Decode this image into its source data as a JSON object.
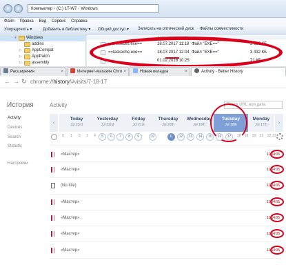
{
  "explorer": {
    "path": [
      "Компьютер",
      "(C:) 1T-W7",
      "Windows"
    ],
    "menu": [
      "Файл",
      "Правка",
      "Вид",
      "Сервис",
      "Справка"
    ],
    "toolbar": [
      "Упорядочить ▾",
      "Добавить в библиотеку ▾",
      "Общий доступ ▾",
      "Записать на оптический диск",
      "Файлы совместимости"
    ],
    "tree": [
      "Windows",
      "addins",
      "AppCompat",
      "AppPatch",
      "assembly"
    ],
    "files": [
      {
        "name": "",
        "date": "дата изменения",
        "type": "",
        "size": ""
      },
      {
        "name": "==msseces.exe==",
        "date": "18.07.2017 11:18",
        "type": "Файл \"EXE==\"",
        "size": "3 636 КБ"
      },
      {
        "name": "==taskeche.exe==",
        "date": "18.07.2017 12:04",
        "type": "Файл \"EXE==\"",
        "size": "3 432 КБ"
      },
      {
        "name": "",
        "date": "01.02.2016 10:25",
        "type": "",
        "size": "71 КБ"
      }
    ]
  },
  "browser": {
    "tabs": [
      {
        "label": "Расширения",
        "color": "#6b7b93"
      },
      {
        "label": "Интернет-магазин Chro",
        "color": "#d44638"
      },
      {
        "label": "Новая вкладка",
        "color": "#8ab4f8"
      },
      {
        "label": "Activity - Better History",
        "color": "#5f6368"
      }
    ],
    "url_prefix": "chrome://",
    "url_host": "history",
    "url_path": "/#visits/7-18-17"
  },
  "sidebar": {
    "title": "История",
    "items": [
      "Activity",
      "Devices",
      "Search",
      "Statistic",
      "Настройки"
    ]
  },
  "main": {
    "heading": "Activity",
    "search_placeholder": "Поиск URL или дата",
    "days": [
      {
        "name": "Today",
        "date": "Jul 23rd"
      },
      {
        "name": "Yesterday",
        "date": "Jul 22nd"
      },
      {
        "name": "Friday",
        "date": "Jul 21st"
      },
      {
        "name": "Thursday",
        "date": "Jul 20th"
      },
      {
        "name": "Wednesday",
        "date": "Jul 19th"
      },
      {
        "name": "Tuesday",
        "date": "Jul 18th"
      },
      {
        "name": "Monday",
        "date": "Jul 17th"
      }
    ],
    "selected_day": "Tuesday",
    "hours": [
      "0",
      "1",
      "2",
      "3",
      "4",
      "5",
      "6",
      "7",
      "8",
      "9",
      "10",
      "11",
      "12",
      "13",
      "14",
      "15",
      "16",
      "17",
      "18",
      "19",
      "20",
      "21",
      "22",
      "23"
    ],
    "selected_hour": "11",
    "visits": [
      {
        "title": "«Мастер»",
        "time": "11:04:05"
      },
      {
        "title": "«Мастер»",
        "time": "11:04:05"
      },
      {
        "title": "(No title)",
        "time": "11:04:05"
      },
      {
        "title": "«Мастер»",
        "time": "11:04:05"
      },
      {
        "title": "«Мастер»",
        "time": "11:04:05"
      },
      {
        "title": "«Мастер»",
        "time": "11:04:05"
      },
      {
        "title": "«Мастер»",
        "time": "11:04:05"
      }
    ]
  }
}
